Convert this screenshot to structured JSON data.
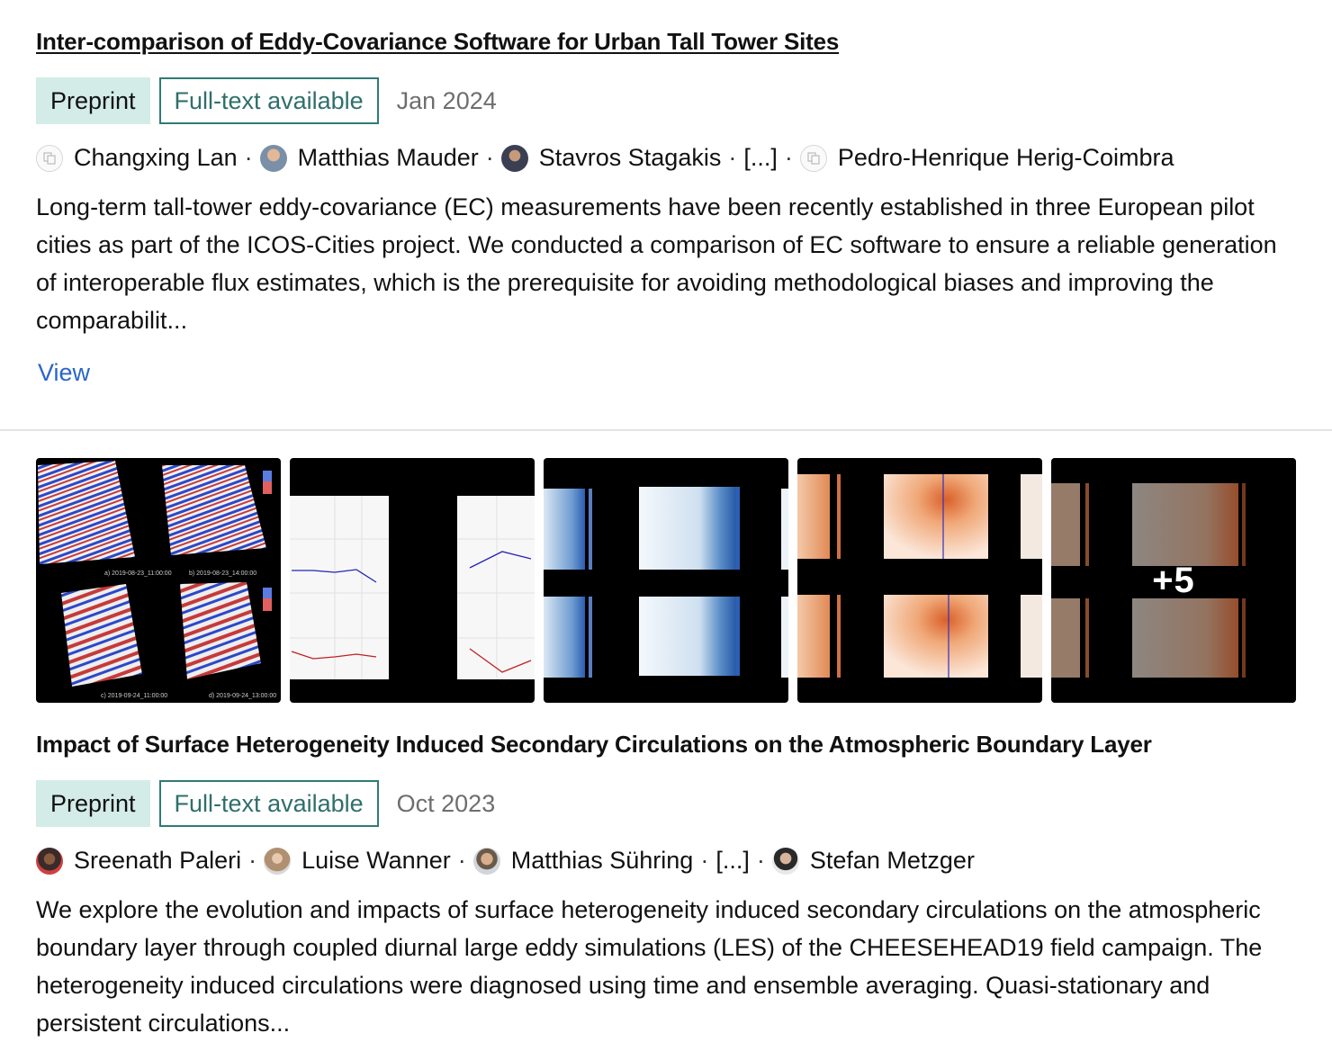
{
  "results": [
    {
      "title": "Inter-comparison of Eddy-Covariance Software for Urban Tall Tower Sites",
      "type_badge": "Preprint",
      "fulltext_badge": "Full-text available",
      "date": "Jan 2024",
      "authors": [
        {
          "name": "Changxing Lan",
          "avatar": "placeholder"
        },
        {
          "name": "Matthias Mauder",
          "avatar": "photo"
        },
        {
          "name": "Stavros Stagakis",
          "avatar": "photo"
        },
        {
          "name": "[...]",
          "avatar": "none"
        },
        {
          "name": "Pedro-Henrique Herig-Coimbra",
          "avatar": "placeholder"
        }
      ],
      "abstract": "Long-term tall-tower eddy-covariance (EC) measurements have been recently established in three European pilot cities as part of the ICOS-Cities project. We conducted a comparison of EC software to ensure a reliable generation of interoperable flux estimates, which is the prerequisite for avoiding methodological biases and improving the comparabilit...",
      "view_label": "View"
    },
    {
      "title": "Impact of Surface Heterogeneity Induced Secondary Circulations on the Atmospheric Boundary Layer",
      "type_badge": "Preprint",
      "fulltext_badge": "Full-text available",
      "date": "Oct 2023",
      "authors": [
        {
          "name": "Sreenath Paleri",
          "avatar": "photo"
        },
        {
          "name": "Luise Wanner",
          "avatar": "photo"
        },
        {
          "name": "Matthias Sühring",
          "avatar": "photo"
        },
        {
          "name": "[...]",
          "avatar": "none"
        },
        {
          "name": "Stefan Metzger",
          "avatar": "photo"
        }
      ],
      "abstract": "We explore the evolution and impacts of surface heterogeneity induced secondary circulations on the atmospheric boundary layer through coupled diurnal large eddy simulations (LES) of the CHEESEHEAD19 field campaign. The heterogeneity induced circulations were diagnosed using time and ensemble averaging. Quasi-stationary and persistent circulations...",
      "figures_more": "+5",
      "figure_labels": [
        "a) 2019-08-23_11:00:00",
        "b) 2019-08-23_14:00:00",
        "c) 2019-09-24_11:00:00",
        "d) 2019-09-24_13:00:00"
      ]
    }
  ],
  "separator": "·",
  "colors": {
    "preprint_bg": "#d3ece7",
    "fulltext_border": "#2f7b77",
    "link": "#2a66c9",
    "date": "#6e6e6e"
  }
}
